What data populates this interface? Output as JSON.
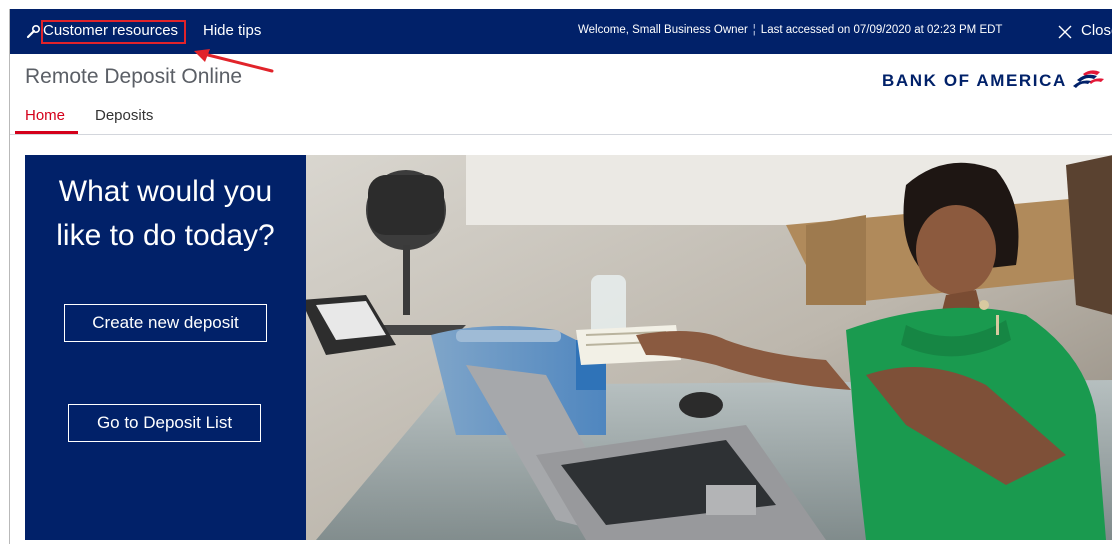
{
  "topbar": {
    "resources_label": "Customer resources",
    "hide_tips_label": "Hide tips",
    "welcome_text": "Welcome, Small Business Owner",
    "separator": "¦",
    "last_accessed_text": "Last accessed on 07/09/2020 at 02:23 PM EDT",
    "close_label": "Close"
  },
  "header": {
    "app_title": "Remote Deposit Online",
    "logo_text": "BANK OF AMERICA"
  },
  "tabs": [
    {
      "label": "Home",
      "active": true
    },
    {
      "label": "Deposits",
      "active": false
    }
  ],
  "hero": {
    "heading": "What would you like to do today?",
    "create_button": "Create new deposit",
    "list_button": "Go to Deposit List"
  },
  "colors": {
    "navy": "#012169",
    "brand_red": "#e31837",
    "active_tab_red": "#d4001a",
    "callout_red": "#e1232a"
  },
  "icons": {
    "resources": "wrench-icon",
    "close": "close-icon",
    "logo": "flag-logo-icon"
  }
}
